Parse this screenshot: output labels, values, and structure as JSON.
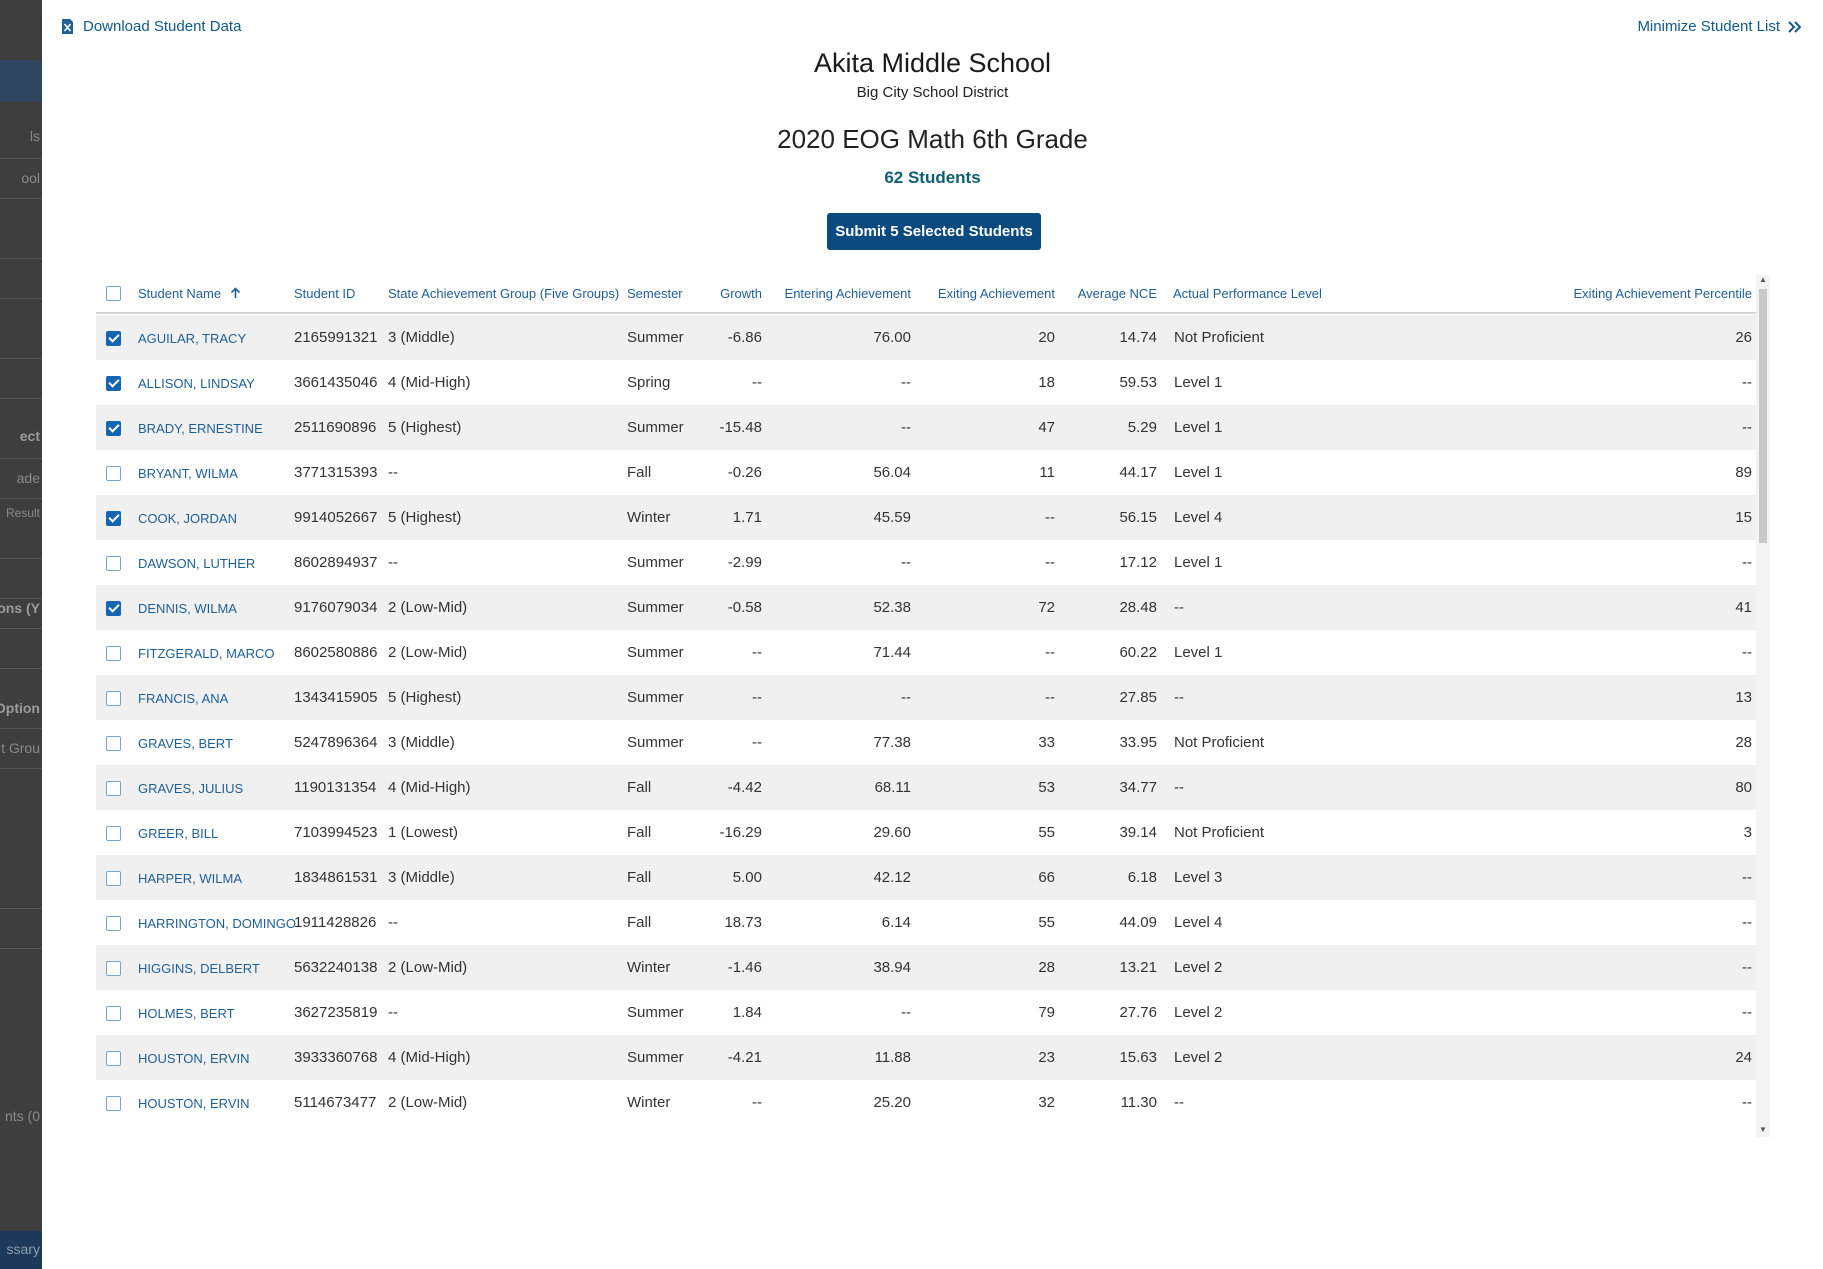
{
  "background_sidebar": {
    "fragments": [
      "ls",
      "ool",
      "ect",
      "ade",
      "Result",
      "ons (Y",
      "Option",
      "t Grou",
      "nts (0",
      "ssary"
    ]
  },
  "toolbar": {
    "download_label": "Download Student Data",
    "minimize_label": "Minimize Student List"
  },
  "header": {
    "school": "Akita Middle School",
    "district": "Big City School District",
    "assessment": "2020 EOG Math 6th Grade",
    "student_count": "62 Students"
  },
  "submit_button": "Submit 5 Selected Students",
  "table": {
    "columns": [
      "Student Name",
      "Student ID",
      "State Achievement Group (Five Groups)",
      "Semester",
      "Growth",
      "Entering Achievement",
      "Exiting Achievement",
      "Average NCE",
      "Actual Performance Level",
      "Exiting Achievement Percentile"
    ],
    "rows": [
      {
        "checked": true,
        "name": "AGUILAR, TRACY",
        "id": "2165991321",
        "group": "3 (Middle)",
        "semester": "Summer",
        "growth": "-6.86",
        "entering": "76.00",
        "exiting": "20",
        "nce": "14.74",
        "level": "Not Proficient",
        "percentile": "26"
      },
      {
        "checked": true,
        "name": "ALLISON, LINDSAY",
        "id": "3661435046",
        "group": "4 (Mid-High)",
        "semester": "Spring",
        "growth": "--",
        "entering": "--",
        "exiting": "18",
        "nce": "59.53",
        "level": "Level 1",
        "percentile": "--"
      },
      {
        "checked": true,
        "name": "BRADY, ERNESTINE",
        "id": "2511690896",
        "group": "5 (Highest)",
        "semester": "Summer",
        "growth": "-15.48",
        "entering": "--",
        "exiting": "47",
        "nce": "5.29",
        "level": "Level 1",
        "percentile": "--"
      },
      {
        "checked": false,
        "name": "BRYANT, WILMA",
        "id": "3771315393",
        "group": "--",
        "semester": "Fall",
        "growth": "-0.26",
        "entering": "56.04",
        "exiting": "11",
        "nce": "44.17",
        "level": "Level 1",
        "percentile": "89"
      },
      {
        "checked": true,
        "name": "COOK, JORDAN",
        "id": "9914052667",
        "group": "5 (Highest)",
        "semester": "Winter",
        "growth": "1.71",
        "entering": "45.59",
        "exiting": "--",
        "nce": "56.15",
        "level": "Level 4",
        "percentile": "15"
      },
      {
        "checked": false,
        "name": "DAWSON, LUTHER",
        "id": "8602894937",
        "group": "--",
        "semester": "Summer",
        "growth": "-2.99",
        "entering": "--",
        "exiting": "--",
        "nce": "17.12",
        "level": "Level 1",
        "percentile": "--"
      },
      {
        "checked": true,
        "name": "DENNIS, WILMA",
        "id": "9176079034",
        "group": "2 (Low-Mid)",
        "semester": "Summer",
        "growth": "-0.58",
        "entering": "52.38",
        "exiting": "72",
        "nce": "28.48",
        "level": "--",
        "percentile": "41"
      },
      {
        "checked": false,
        "name": "FITZGERALD, MARCO",
        "id": "8602580886",
        "group": "2 (Low-Mid)",
        "semester": "Summer",
        "growth": "--",
        "entering": "71.44",
        "exiting": "--",
        "nce": "60.22",
        "level": "Level 1",
        "percentile": "--"
      },
      {
        "checked": false,
        "name": "FRANCIS, ANA",
        "id": "1343415905",
        "group": "5 (Highest)",
        "semester": "Summer",
        "growth": "--",
        "entering": "--",
        "exiting": "--",
        "nce": "27.85",
        "level": "--",
        "percentile": "13"
      },
      {
        "checked": false,
        "name": "GRAVES, BERT",
        "id": "5247896364",
        "group": "3 (Middle)",
        "semester": "Summer",
        "growth": "--",
        "entering": "77.38",
        "exiting": "33",
        "nce": "33.95",
        "level": "Not Proficient",
        "percentile": "28"
      },
      {
        "checked": false,
        "name": "GRAVES, JULIUS",
        "id": "1190131354",
        "group": "4 (Mid-High)",
        "semester": "Fall",
        "growth": "-4.42",
        "entering": "68.11",
        "exiting": "53",
        "nce": "34.77",
        "level": "--",
        "percentile": "80"
      },
      {
        "checked": false,
        "name": "GREER, BILL",
        "id": "7103994523",
        "group": "1 (Lowest)",
        "semester": "Fall",
        "growth": "-16.29",
        "entering": "29.60",
        "exiting": "55",
        "nce": "39.14",
        "level": "Not Proficient",
        "percentile": "3"
      },
      {
        "checked": false,
        "name": "HARPER, WILMA",
        "id": "1834861531",
        "group": "3 (Middle)",
        "semester": "Fall",
        "growth": "5.00",
        "entering": "42.12",
        "exiting": "66",
        "nce": "6.18",
        "level": "Level 3",
        "percentile": "--"
      },
      {
        "checked": false,
        "name": "HARRINGTON, DOMINGO",
        "id": "1911428826",
        "group": "--",
        "semester": "Fall",
        "growth": "18.73",
        "entering": "6.14",
        "exiting": "55",
        "nce": "44.09",
        "level": "Level 4",
        "percentile": "--"
      },
      {
        "checked": false,
        "name": "HIGGINS, DELBERT",
        "id": "5632240138",
        "group": "2 (Low-Mid)",
        "semester": "Winter",
        "growth": "-1.46",
        "entering": "38.94",
        "exiting": "28",
        "nce": "13.21",
        "level": "Level 2",
        "percentile": "--"
      },
      {
        "checked": false,
        "name": "HOLMES, BERT",
        "id": "3627235819",
        "group": "--",
        "semester": "Summer",
        "growth": "1.84",
        "entering": "--",
        "exiting": "79",
        "nce": "27.76",
        "level": "Level 2",
        "percentile": "--"
      },
      {
        "checked": false,
        "name": "HOUSTON, ERVIN",
        "id": "3933360768",
        "group": "4 (Mid-High)",
        "semester": "Summer",
        "growth": "-4.21",
        "entering": "11.88",
        "exiting": "23",
        "nce": "15.63",
        "level": "Level 2",
        "percentile": "24"
      },
      {
        "checked": false,
        "name": "HOUSTON, ERVIN",
        "id": "5114673477",
        "group": "2 (Low-Mid)",
        "semester": "Winter",
        "growth": "--",
        "entering": "25.20",
        "exiting": "32",
        "nce": "11.30",
        "level": "--",
        "percentile": "--"
      }
    ]
  },
  "colors": {
    "accent": "#0b4a7e",
    "link": "#1e5f96",
    "count": "#0e5f73",
    "stripe": "#f0f0f0"
  }
}
